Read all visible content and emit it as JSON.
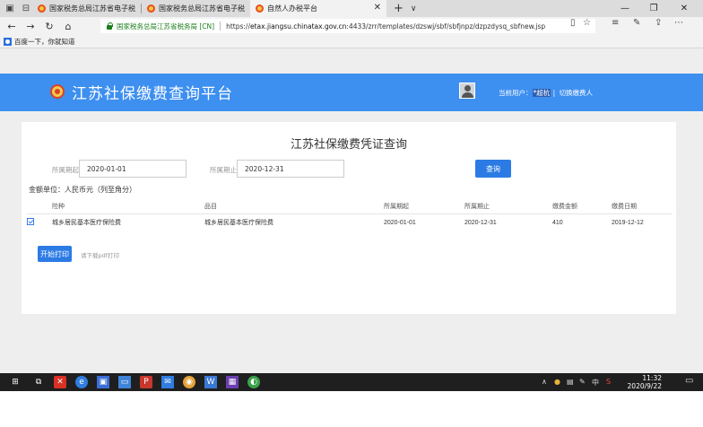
{
  "browser": {
    "tabs": [
      {
        "label": "国家税务总局江苏省电子税"
      },
      {
        "label": "国家税务总局江苏省电子税"
      },
      {
        "label": "自然人办税平台"
      }
    ],
    "new_tab": "+",
    "tab_menu": "∨",
    "site_identity": "国家税务总局江苏省税务局 [CN]",
    "url_prefix": "https://",
    "url_host": "etax.jiangsu.chinatax.gov.cn",
    "url_path": ":4433/zrr/templates/dzswj/sbf/sbfjnpz/dzpzdysq_sbfnew.jsp",
    "favorite_item": "百度一下，你就知道"
  },
  "header": {
    "site_title": "江苏社保缴费查询平台",
    "current_user_label": "当前用户：",
    "user_name": "*超杭",
    "separator": "|",
    "switch_payer": "切换缴费人"
  },
  "query": {
    "title": "江苏社保缴费凭证查询",
    "start_label": "所属期起:",
    "start_value": "2020-01-01",
    "end_label": "所属期止:",
    "end_value": "2020-12-31",
    "query_button": "查询",
    "unit_note": "金额单位：人民币元（列至角分）"
  },
  "table": {
    "columns": [
      "险种",
      "品目",
      "所属期起",
      "所属期止",
      "缴费金额",
      "缴费日期"
    ],
    "rows": [
      {
        "checked": true,
        "insurance": "城乡居民基本医疗保险费",
        "item": "城乡居民基本医疗保险费",
        "start": "2020-01-01",
        "end": "2020-12-31",
        "amount": "410",
        "date": "2019-12-12"
      }
    ]
  },
  "actions": {
    "print_button": "开始打印",
    "pdf_link": "请下载pdf打印"
  },
  "taskbar": {
    "tray_ime": "中",
    "time": "11:32",
    "date": "2020/9/22"
  },
  "colors": {
    "header_blue": "#3d8ff0",
    "button_blue": "#2c7be5",
    "page_bg": "#eeeeee",
    "taskbar": "#1f1f1f"
  }
}
